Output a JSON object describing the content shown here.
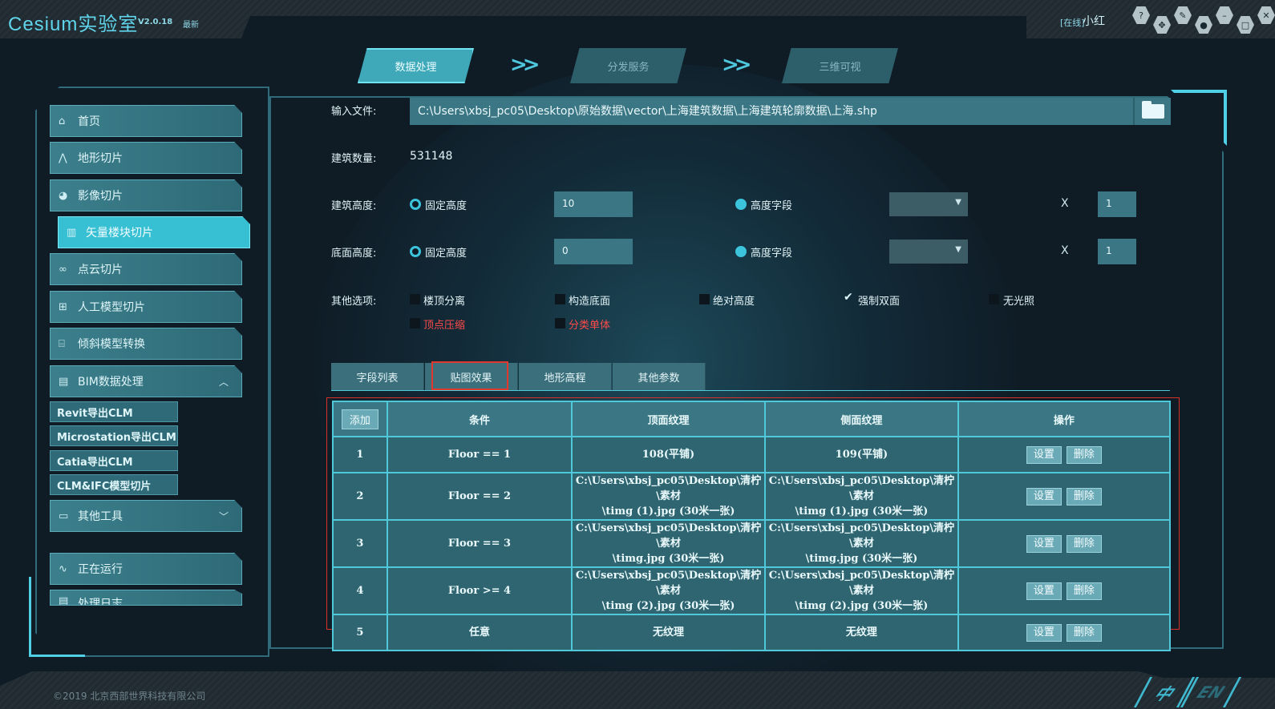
{
  "app": {
    "title": "Cesium实验室",
    "version": "V2.0.18",
    "latest": "最新"
  },
  "user": {
    "status": "[在线]",
    "name": "小红"
  },
  "titlebar_icons": [
    "help-icon",
    "move-icon",
    "settings-icon",
    "user-icon",
    "minimize-icon",
    "maximize-icon",
    "close-icon"
  ],
  "steps": [
    {
      "label": "数据处理",
      "active": true
    },
    {
      "label": "分发服务",
      "active": false
    },
    {
      "label": "三维可视",
      "active": false
    }
  ],
  "sidebar": {
    "items": [
      {
        "label": "首页",
        "icon": "home-icon"
      },
      {
        "label": "地形切片",
        "icon": "terrain-icon"
      },
      {
        "label": "影像切片",
        "icon": "image-icon"
      },
      {
        "label": "矢量楼块切片",
        "icon": "building-icon",
        "active": true
      },
      {
        "label": "点云切片",
        "icon": "pointcloud-icon"
      },
      {
        "label": "人工模型切片",
        "icon": "model-icon"
      },
      {
        "label": "倾斜模型转换",
        "icon": "oblique-icon"
      },
      {
        "label": "BIM数据处理",
        "icon": "bim-icon",
        "expanded": true
      },
      {
        "label": "其他工具",
        "icon": "tools-icon"
      },
      {
        "label": "正在运行",
        "icon": "pulse-icon"
      },
      {
        "label": "处理日志",
        "icon": "log-icon"
      }
    ],
    "bim_sub": [
      "Revit导出CLM",
      "Microstation导出CLM",
      "Catia导出CLM",
      "CLM&IFC模型切片"
    ]
  },
  "form": {
    "input_file_label": "输入文件:",
    "input_file_value": "C:\\Users\\xbsj_pc05\\Desktop\\原始数据\\vector\\上海建筑数据\\上海建筑轮廓数据\\上海.shp",
    "count_label": "建筑数量:",
    "count_value": "531148",
    "height_label": "建筑高度:",
    "base_label": "底面高度:",
    "fixed_height": "固定高度",
    "height_field": "高度字段",
    "height_value": "10",
    "base_value": "0",
    "x": "X",
    "height_multiplier": "1",
    "base_multiplier": "1",
    "other_label": "其他选项:",
    "options": [
      {
        "label": "楼顶分离",
        "checked": false,
        "color": "#e2f4f7"
      },
      {
        "label": "构造底面",
        "checked": false,
        "color": "#e2f4f7"
      },
      {
        "label": "绝对高度",
        "checked": false,
        "color": "#e2f4f7"
      },
      {
        "label": "强制双面",
        "checked": true,
        "color": "#e2f4f7"
      },
      {
        "label": "无光照",
        "checked": false,
        "color": "#e2f4f7"
      },
      {
        "label": "顶点压缩",
        "checked": false,
        "color": "#ff4a4a"
      },
      {
        "label": "分类单体",
        "checked": false,
        "color": "#ff4a4a"
      }
    ]
  },
  "tabs": [
    {
      "label": "字段列表"
    },
    {
      "label": "贴图效果",
      "highlighted": true
    },
    {
      "label": "地形高程"
    },
    {
      "label": "其他参数"
    }
  ],
  "table": {
    "add_label": "添加",
    "headers": [
      "条件",
      "顶面纹理",
      "侧面纹理",
      "操作"
    ],
    "set_label": "设置",
    "delete_label": "删除",
    "rows": [
      {
        "index": "1",
        "condition": "Floor == 1",
        "top1": "108(平铺)",
        "top2": "",
        "side1": "109(平铺)",
        "side2": ""
      },
      {
        "index": "2",
        "condition": "Floor == 2",
        "top1": "C:\\Users\\xbsj_pc05\\Desktop\\清柠\\素材",
        "top2": "\\timg (1).jpg (30米一张)",
        "side1": "C:\\Users\\xbsj_pc05\\Desktop\\清柠\\素材",
        "side2": "\\timg (1).jpg (30米一张)"
      },
      {
        "index": "3",
        "condition": "Floor == 3",
        "top1": "C:\\Users\\xbsj_pc05\\Desktop\\清柠\\素材",
        "top2": "\\timg.jpg (30米一张)",
        "side1": "C:\\Users\\xbsj_pc05\\Desktop\\清柠\\素材",
        "side2": "\\timg.jpg (30米一张)"
      },
      {
        "index": "4",
        "condition": "Floor >= 4",
        "top1": "C:\\Users\\xbsj_pc05\\Desktop\\清柠\\素材",
        "top2": "\\timg (2).jpg (30米一张)",
        "side1": "C:\\Users\\xbsj_pc05\\Desktop\\清柠\\素材",
        "side2": "\\timg (2).jpg (30米一张)"
      },
      {
        "index": "5",
        "condition": "任意",
        "top1": "无纹理",
        "top2": "",
        "side1": "无纹理",
        "side2": ""
      }
    ]
  },
  "footer": {
    "copyright": "©2019 北京西部世界科技有限公司",
    "lang_zh": "中",
    "lang_en": "EN"
  }
}
